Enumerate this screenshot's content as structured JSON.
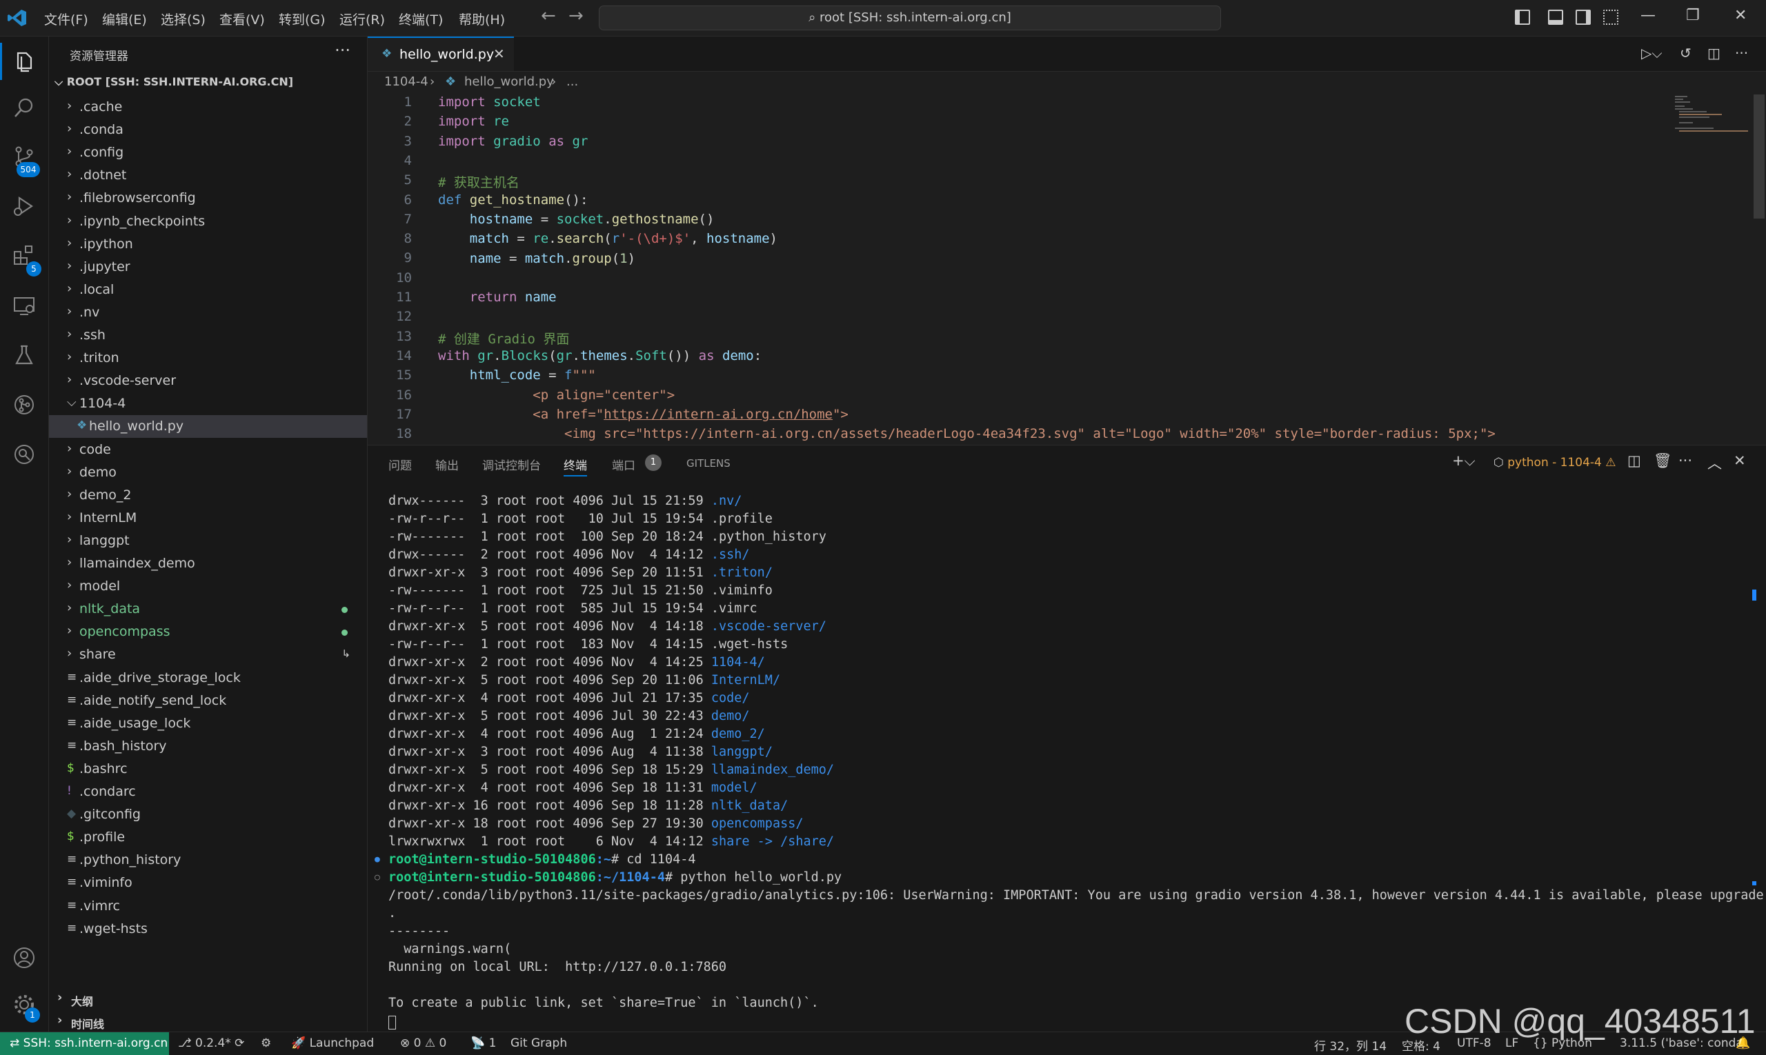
{
  "titlebar": {
    "menu": [
      "文件(F)",
      "编辑(E)",
      "选择(S)",
      "查看(V)",
      "转到(G)",
      "运行(R)",
      "终端(T)",
      "帮助(H)"
    ],
    "search": "root [SSH: ssh.intern-ai.org.cn]"
  },
  "activity": {
    "scm_badge": "504",
    "ext_badge": "5",
    "settings_badge": "1"
  },
  "explorer": {
    "title": "资源管理器",
    "root": "ROOT [SSH: SSH.INTERN-AI.ORG.CN]",
    "items": [
      {
        "label": ".cache",
        "type": "folder"
      },
      {
        "label": ".conda",
        "type": "folder"
      },
      {
        "label": ".config",
        "type": "folder"
      },
      {
        "label": ".dotnet",
        "type": "folder"
      },
      {
        "label": ".filebrowserconfig",
        "type": "folder"
      },
      {
        "label": ".ipynb_checkpoints",
        "type": "folder"
      },
      {
        "label": ".ipython",
        "type": "folder"
      },
      {
        "label": ".jupyter",
        "type": "folder"
      },
      {
        "label": ".local",
        "type": "folder"
      },
      {
        "label": ".nv",
        "type": "folder"
      },
      {
        "label": ".ssh",
        "type": "folder"
      },
      {
        "label": ".triton",
        "type": "folder"
      },
      {
        "label": ".vscode-server",
        "type": "folder"
      },
      {
        "label": "1104-4",
        "type": "folder-open"
      },
      {
        "label": "hello_world.py",
        "type": "python-file"
      },
      {
        "label": "code",
        "type": "folder"
      },
      {
        "label": "demo",
        "type": "folder"
      },
      {
        "label": "demo_2",
        "type": "folder"
      },
      {
        "label": "InternLM",
        "type": "folder"
      },
      {
        "label": "langgpt",
        "type": "folder"
      },
      {
        "label": "llamaindex_demo",
        "type": "folder"
      },
      {
        "label": "model",
        "type": "folder"
      },
      {
        "label": "nltk_data",
        "type": "folder-modified"
      },
      {
        "label": "opencompass",
        "type": "folder-modified"
      },
      {
        "label": "share",
        "type": "folder-link"
      },
      {
        "label": ".aide_drive_storage_lock",
        "type": "file"
      },
      {
        "label": ".aide_notify_send_lock",
        "type": "file"
      },
      {
        "label": ".aide_usage_lock",
        "type": "file"
      },
      {
        "label": ".bash_history",
        "type": "file"
      },
      {
        "label": ".bashrc",
        "type": "shell-file"
      },
      {
        "label": ".condarc",
        "type": "yaml-file"
      },
      {
        "label": ".gitconfig",
        "type": "git-file"
      },
      {
        "label": ".profile",
        "type": "shell-file"
      },
      {
        "label": ".python_history",
        "type": "file"
      },
      {
        "label": ".viminfo",
        "type": "file"
      },
      {
        "label": ".vimrc",
        "type": "file"
      },
      {
        "label": ".wget-hsts",
        "type": "file"
      }
    ],
    "outline": "大纲",
    "timeline": "时间线"
  },
  "editor": {
    "tab": "hello_world.py",
    "breadcrumb": [
      "1104-4",
      "hello_world.py",
      "..."
    ],
    "line_numbers": [
      "1",
      "2",
      "3",
      "4",
      "5",
      "6",
      "7",
      "8",
      "9",
      "10",
      "11",
      "12",
      "13",
      "14",
      "15",
      "16",
      "17",
      "18"
    ]
  },
  "panel": {
    "tabs": [
      "问题",
      "输出",
      "调试控制台",
      "终端",
      "端口",
      "GITLENS"
    ],
    "ports_count": "1",
    "terminal_name": "python - 1104-4",
    "listing": [
      {
        "perm": "drwx------",
        "links": "3",
        "size": "4096",
        "date": "Jul 15 21:59",
        "name": ".nv",
        "suffix": "/",
        "dir": true
      },
      {
        "perm": "-rw-r--r--",
        "links": "1",
        "size": "10",
        "date": "Jul 15 19:54",
        "name": ".profile",
        "suffix": "",
        "dir": false
      },
      {
        "perm": "-rw-------",
        "links": "1",
        "size": "100",
        "date": "Sep 20 18:24",
        "name": ".python_history",
        "suffix": "",
        "dir": false
      },
      {
        "perm": "drwx------",
        "links": "2",
        "size": "4096",
        "date": "Nov  4 14:12",
        "name": ".ssh",
        "suffix": "/",
        "dir": true
      },
      {
        "perm": "drwxr-xr-x",
        "links": "3",
        "size": "4096",
        "date": "Sep 20 11:51",
        "name": ".triton",
        "suffix": "/",
        "dir": true
      },
      {
        "perm": "-rw-------",
        "links": "1",
        "size": "725",
        "date": "Jul 15 21:50",
        "name": ".viminfo",
        "suffix": "",
        "dir": false
      },
      {
        "perm": "-rw-r--r--",
        "links": "1",
        "size": "585",
        "date": "Jul 15 19:54",
        "name": ".vimrc",
        "suffix": "",
        "dir": false
      },
      {
        "perm": "drwxr-xr-x",
        "links": "5",
        "size": "4096",
        "date": "Nov  4 14:18",
        "name": ".vscode-server",
        "suffix": "/",
        "dir": true
      },
      {
        "perm": "-rw-r--r--",
        "links": "1",
        "size": "183",
        "date": "Nov  4 14:15",
        "name": ".wget-hsts",
        "suffix": "",
        "dir": false
      },
      {
        "perm": "drwxr-xr-x",
        "links": "2",
        "size": "4096",
        "date": "Nov  4 14:25",
        "name": "1104-4",
        "suffix": "/",
        "dir": true
      },
      {
        "perm": "drwxr-xr-x",
        "links": "5",
        "size": "4096",
        "date": "Sep 20 11:06",
        "name": "InternLM",
        "suffix": "/",
        "dir": true
      },
      {
        "perm": "drwxr-xr-x",
        "links": "4",
        "size": "4096",
        "date": "Jul 21 17:35",
        "name": "code",
        "suffix": "/",
        "dir": true
      },
      {
        "perm": "drwxr-xr-x",
        "links": "5",
        "size": "4096",
        "date": "Jul 30 22:43",
        "name": "demo",
        "suffix": "/",
        "dir": true
      },
      {
        "perm": "drwxr-xr-x",
        "links": "4",
        "size": "4096",
        "date": "Aug  1 21:24",
        "name": "demo_2",
        "suffix": "/",
        "dir": true
      },
      {
        "perm": "drwxr-xr-x",
        "links": "3",
        "size": "4096",
        "date": "Aug  4 11:38",
        "name": "langgpt",
        "suffix": "/",
        "dir": true
      },
      {
        "perm": "drwxr-xr-x",
        "links": "5",
        "size": "4096",
        "date": "Sep 18 15:29",
        "name": "llamaindex_demo",
        "suffix": "/",
        "dir": true
      },
      {
        "perm": "drwxr-xr-x",
        "links": "4",
        "size": "4096",
        "date": "Sep 18 11:31",
        "name": "model",
        "suffix": "/",
        "dir": true
      },
      {
        "perm": "drwxr-xr-x",
        "links": "16",
        "size": "4096",
        "date": "Sep 18 11:28",
        "name": "nltk_data",
        "suffix": "/",
        "dir": true
      },
      {
        "perm": "drwxr-xr-x",
        "links": "18",
        "size": "4096",
        "date": "Sep 27 19:30",
        "name": "opencompass",
        "suffix": "/",
        "dir": true
      },
      {
        "perm": "lrwxrwxrwx",
        "links": "1",
        "size": "6",
        "date": "Nov  4 14:12",
        "name": "share",
        "suffix": " -> /share/",
        "dir": true
      }
    ],
    "cmd1_prompt": "root@intern-studio-50104806",
    "cmd1_path": ":~",
    "cmd1_text": "# cd 1104-4",
    "cmd2_prompt": "root@intern-studio-50104806",
    "cmd2_path": ":~/1104-4",
    "cmd2_text": "# python hello_world.py",
    "output": [
      "/root/.conda/lib/python3.11/site-packages/gradio/analytics.py:106: UserWarning: IMPORTANT: You are using gradio version 4.38.1, however version 4.44.1 is available, please upgrade",
      ".",
      "--------",
      "  warnings.warn(",
      "Running on local URL:  http://127.0.0.1:7860",
      "",
      "To create a public link, set `share=True` in `launch()`."
    ]
  },
  "statusbar": {
    "remote": "SSH: ssh.intern-ai.org.cn",
    "branch": "0.2.4*",
    "launchpad": "Launchpad",
    "errors": "0",
    "warnings": "0",
    "ports": "1",
    "gitgraph": "Git Graph",
    "position": "行 32，列 14",
    "spaces": "空格: 4",
    "encoding": "UTF-8",
    "eol": "LF",
    "language": "Python",
    "interpreter": "3.11.5 ('base': conda)"
  },
  "watermark": "CSDN @qq_40348511"
}
